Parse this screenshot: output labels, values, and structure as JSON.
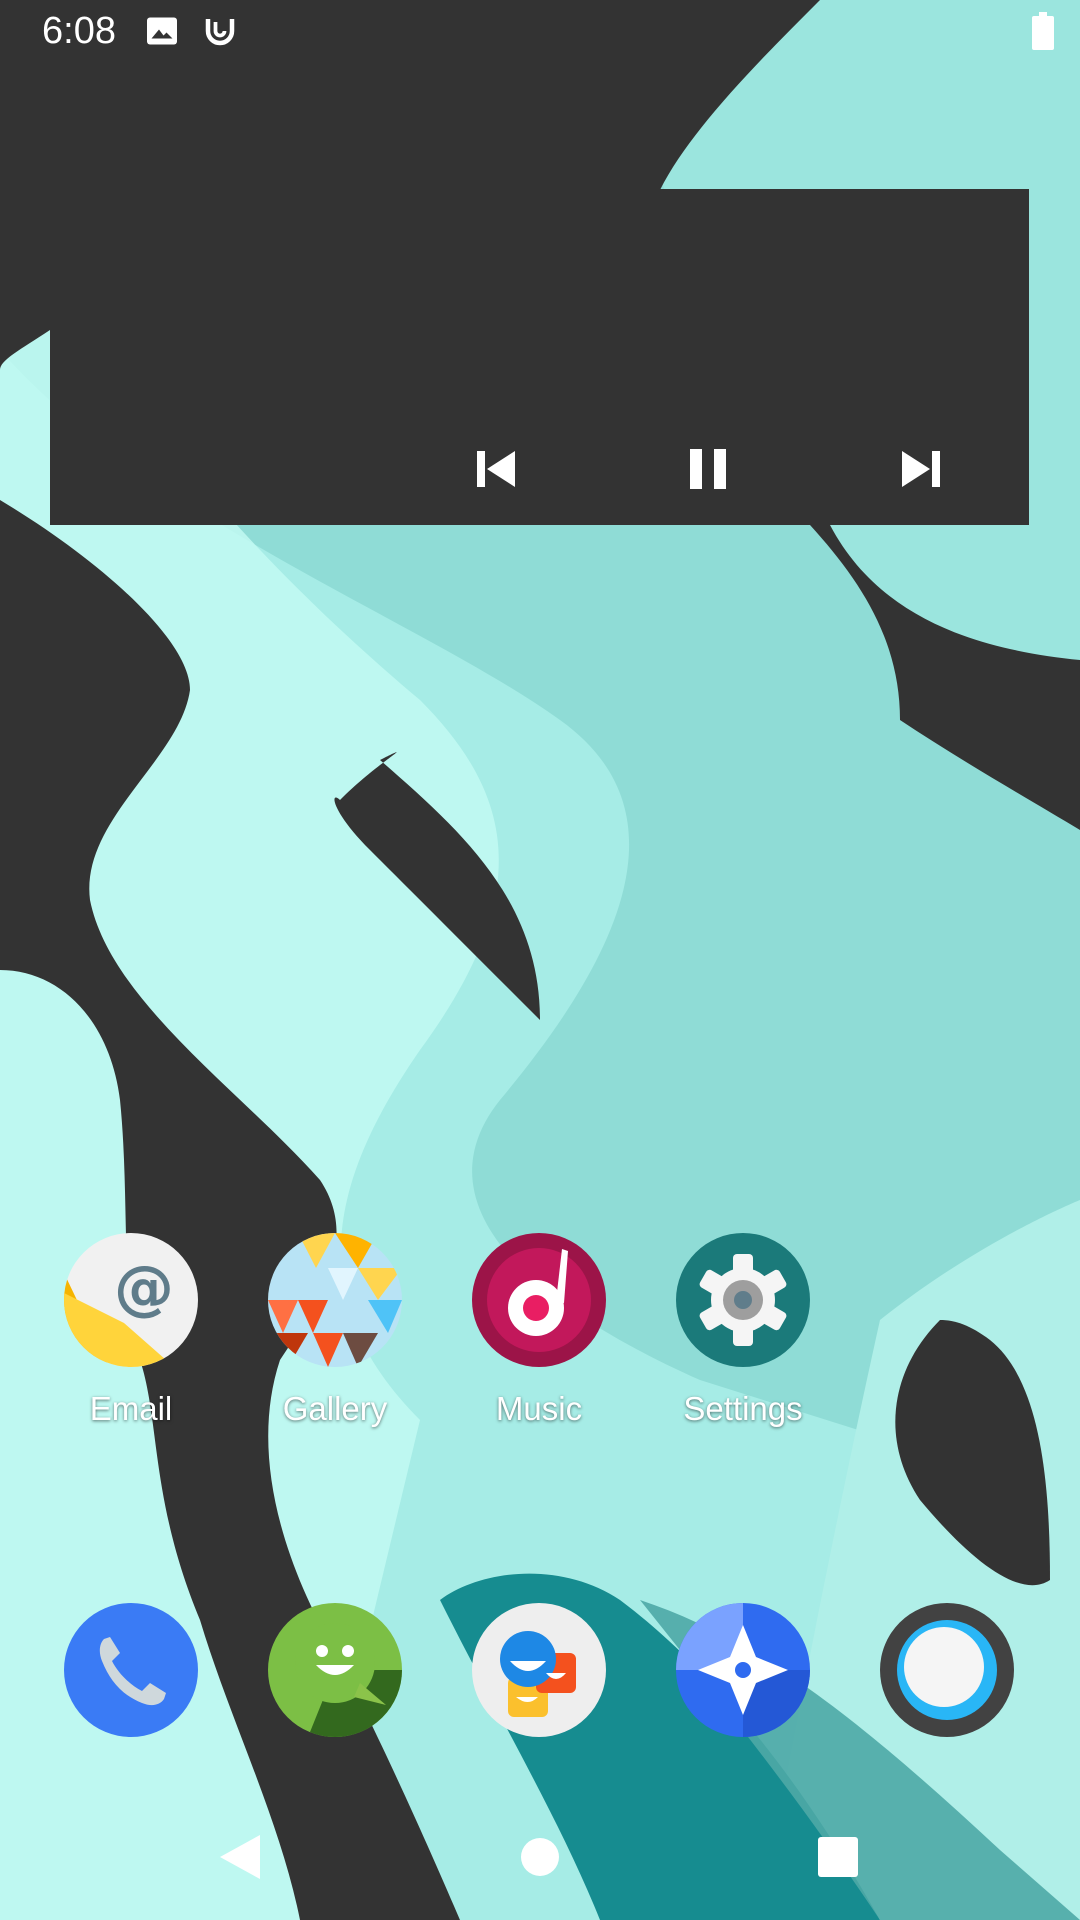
{
  "status_bar": {
    "time": "6:08",
    "icons": [
      "image-icon",
      "headset-notification-icon",
      "battery-icon"
    ]
  },
  "music_widget": {
    "controls": [
      "previous-track-icon",
      "pause-icon",
      "next-track-icon"
    ]
  },
  "home_apps": [
    {
      "label": "Email",
      "icon": "email-icon"
    },
    {
      "label": "Gallery",
      "icon": "gallery-icon"
    },
    {
      "label": "Music",
      "icon": "music-icon"
    },
    {
      "label": "Settings",
      "icon": "settings-icon"
    }
  ],
  "dock": [
    {
      "icon": "phone-icon"
    },
    {
      "icon": "messaging-icon"
    },
    {
      "icon": "contacts-icon"
    },
    {
      "icon": "browser-icon"
    },
    {
      "icon": "camera-icon"
    }
  ],
  "nav_bar": [
    "back-icon",
    "home-icon",
    "recents-icon"
  ],
  "colors": {
    "wallpaper_dark": "#333333",
    "wallpaper_teal": "#8fdcd6",
    "phone_blue": "#3a7bf5",
    "messaging_green": "#7cbf45",
    "music_red": "#b8154e",
    "settings_teal": "#1b7a7a"
  }
}
